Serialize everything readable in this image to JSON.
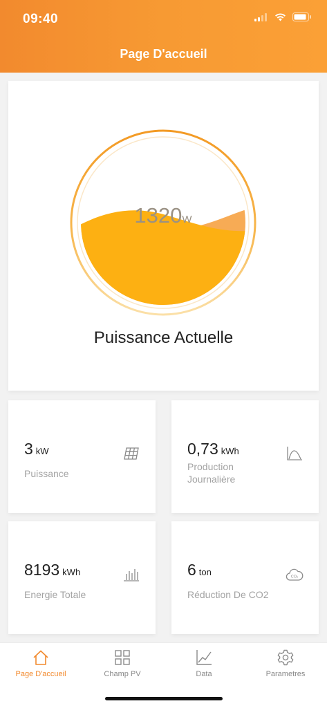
{
  "status_bar": {
    "time": "09:40",
    "icons": [
      "signal-icon",
      "wifi-icon",
      "battery-icon"
    ]
  },
  "header": {
    "title": "Page D'accueil"
  },
  "power": {
    "value": "1320",
    "unit": "W",
    "label": "Puissance Actuelle"
  },
  "stats": [
    {
      "value": "3",
      "unit": "kW",
      "label": "Puissance",
      "icon": "solar-panel-icon"
    },
    {
      "value": "0,73",
      "unit": "kWh",
      "label_line1": "Production",
      "label_line2": "Journalière",
      "icon": "production-curve-icon"
    },
    {
      "value": "8193",
      "unit": "kWh",
      "label": "Energie Totale",
      "icon": "bar-chart-icon"
    },
    {
      "value": "6",
      "unit": "ton",
      "label": "Réduction De CO2",
      "icon": "co2-cloud-icon"
    }
  ],
  "nav": [
    {
      "label": "Page D'accueil",
      "icon": "home-icon",
      "active": true
    },
    {
      "label": "Champ PV",
      "icon": "grid-icon",
      "active": false
    },
    {
      "label": "Data",
      "icon": "line-chart-icon",
      "active": false
    },
    {
      "label": "Parametres",
      "icon": "gear-icon",
      "active": false
    }
  ],
  "colors": {
    "accent": "#f28a2e",
    "gauge_fill": "#fdb012",
    "card_bg": "#ffffff",
    "page_bg": "#f2f2f2"
  }
}
